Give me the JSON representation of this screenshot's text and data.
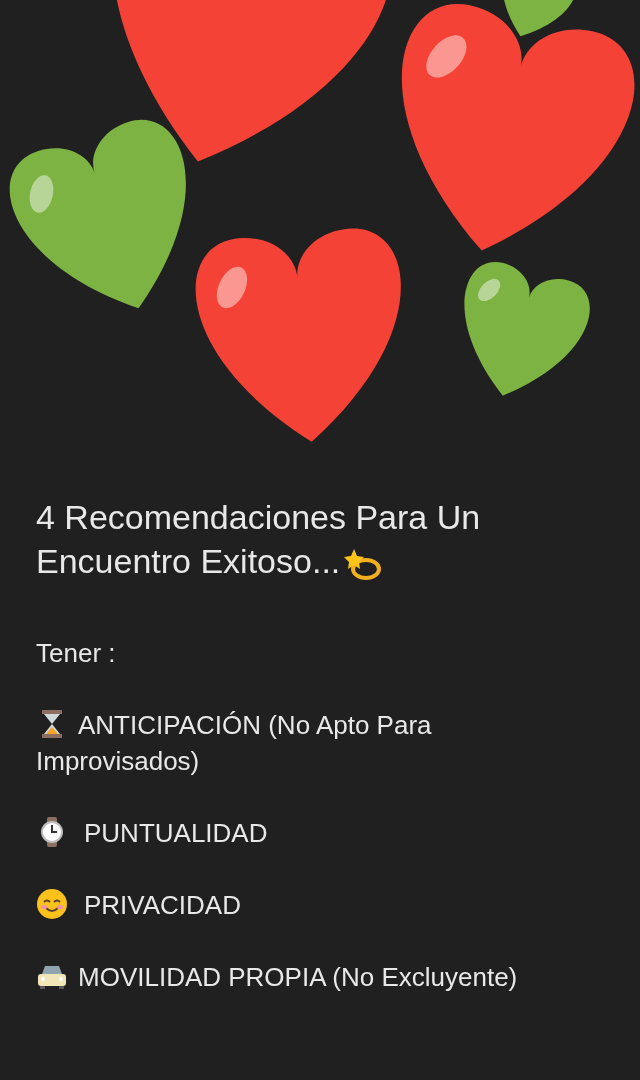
{
  "post": {
    "title": "4 Recomendaciones Para Un Encuentro Exitoso...",
    "title_icon": {
      "kind": "dizzy"
    },
    "intro": "Tener :",
    "items": [
      {
        "kind": "hourglass",
        "text": "ANTICIPACIÓN (No Apto Para Improvisados)"
      },
      {
        "kind": "watch",
        "text": "PUNTUALIDAD"
      },
      {
        "kind": "smile",
        "text": "PRIVACIDAD"
      },
      {
        "kind": "car",
        "text": "MOVILIDAD PROPIA (No Excluyente)"
      }
    ]
  }
}
